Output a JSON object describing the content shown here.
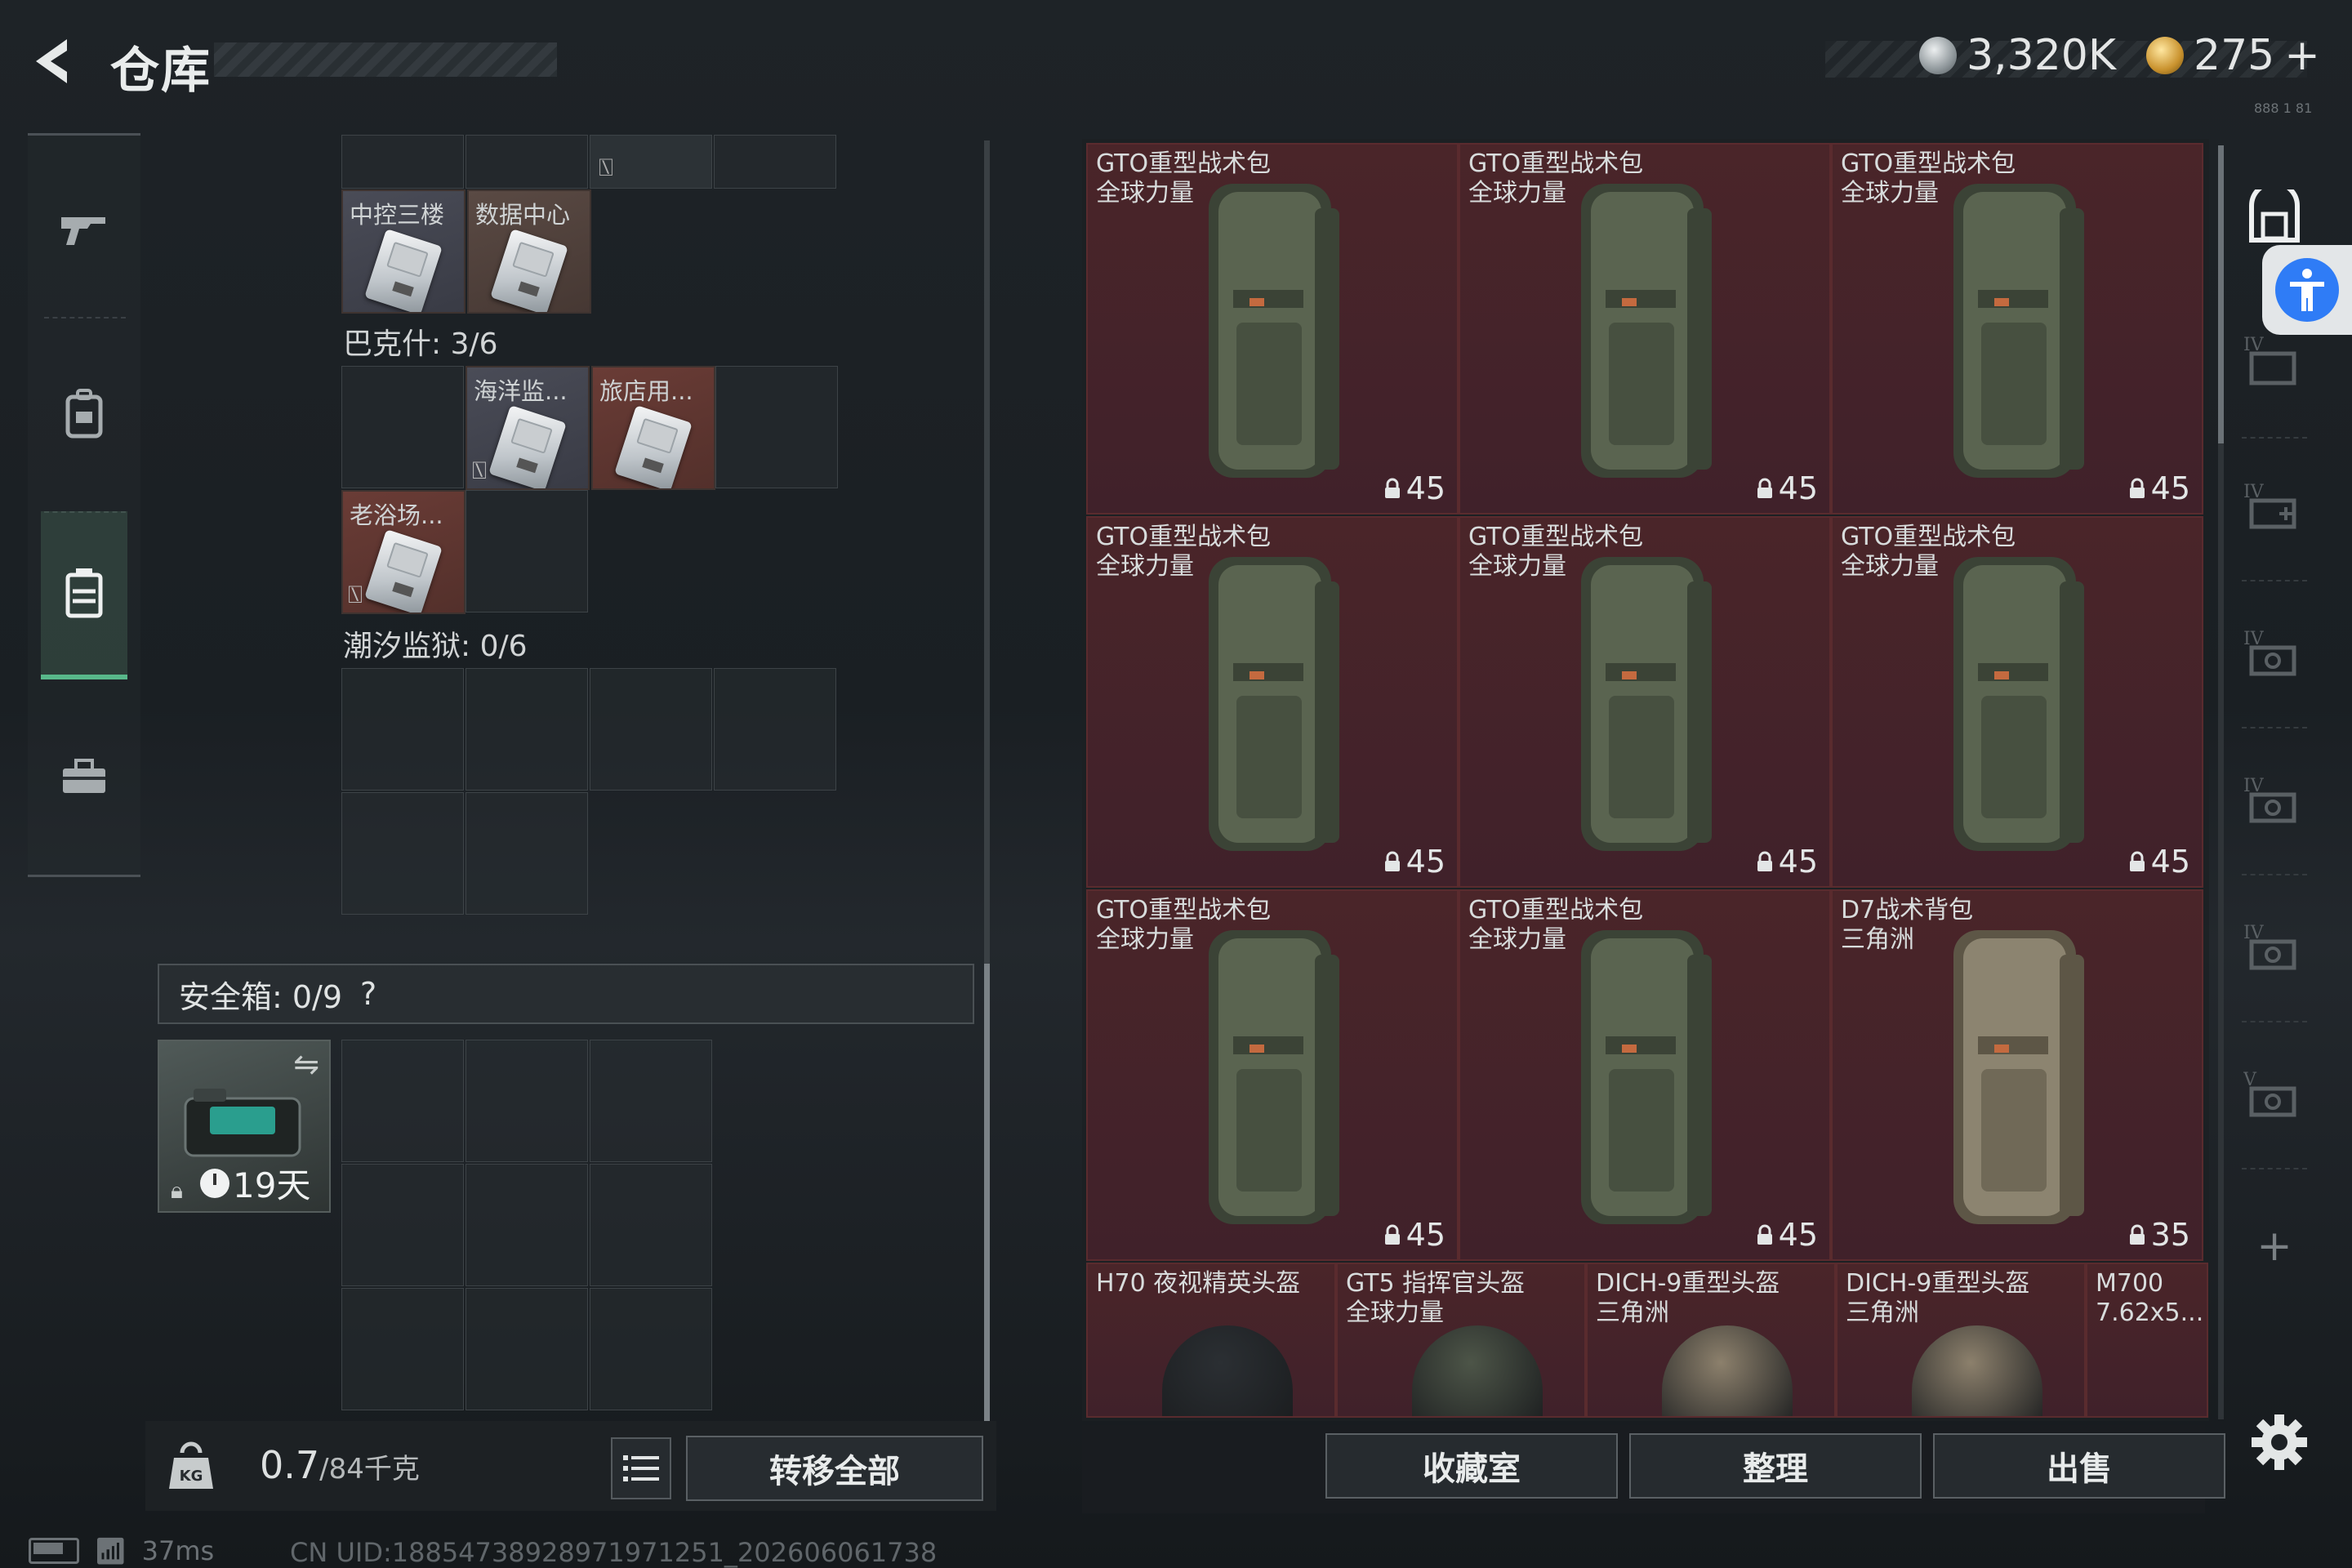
{
  "header": {
    "title": "仓库",
    "currency_silver": "3,320K",
    "currency_gold": "275",
    "currency_gold_plus": "+",
    "corner_small": "888 1 81"
  },
  "nav": {
    "items": [
      {
        "icon": "gun-icon"
      },
      {
        "icon": "backpack-icon"
      },
      {
        "icon": "storage-box-icon",
        "active": true
      },
      {
        "icon": "toolbox-icon"
      }
    ]
  },
  "left_storage": {
    "top_cards": [
      {
        "label": "中控三楼"
      },
      {
        "label": "数据中心"
      }
    ],
    "bakeshi_label": "巴克什: 3/6",
    "mid_cards": [
      {
        "label": "海洋监..."
      },
      {
        "label": "旅店用..."
      },
      {
        "label": "老浴场..."
      }
    ],
    "chaoxi_label": "潮汐监狱: 0/6",
    "safe_label": "安全箱: 0/9",
    "safe_help": "?",
    "safe_days": "19天",
    "weight_value": "0.7",
    "weight_max": "/84千克",
    "weight_unit_icon": "KG",
    "transfer_all": "转移全部"
  },
  "items": [
    {
      "name": "GTO重型战术包\n全球力量",
      "capacity": "45"
    },
    {
      "name": "GTO重型战术包\n全球力量",
      "capacity": "45"
    },
    {
      "name": "GTO重型战术包\n全球力量",
      "capacity": "45"
    },
    {
      "name": "GTO重型战术包\n全球力量",
      "capacity": "45"
    },
    {
      "name": "GTO重型战术包\n全球力量",
      "capacity": "45"
    },
    {
      "name": "GTO重型战术包\n全球力量",
      "capacity": "45"
    },
    {
      "name": "GTO重型战术包\n全球力量",
      "capacity": "45"
    },
    {
      "name": "GTO重型战术包\n全球力量",
      "capacity": "45"
    },
    {
      "name": "D7战术背包\n三角洲",
      "capacity": "35"
    }
  ],
  "helmets": [
    {
      "name": "H70 夜视精英头盔"
    },
    {
      "name": "GT5 指挥官头盔\n全球力量"
    },
    {
      "name": "DICH-9重型头盔\n三角洲"
    },
    {
      "name": "DICH-9重型头盔\n三角洲"
    },
    {
      "name": "M700\n7.62x5..."
    }
  ],
  "bottom_buttons": {
    "collection": "收藏室",
    "organize": "整理",
    "sell": "出售"
  },
  "status": {
    "ping": "37ms",
    "uid": "CN UID:18854738928971971251_202606061738"
  },
  "colors": {
    "item_bg": "#4a2529",
    "active_accent": "#58b88a",
    "accessibility_blue": "#2f7cf6"
  }
}
